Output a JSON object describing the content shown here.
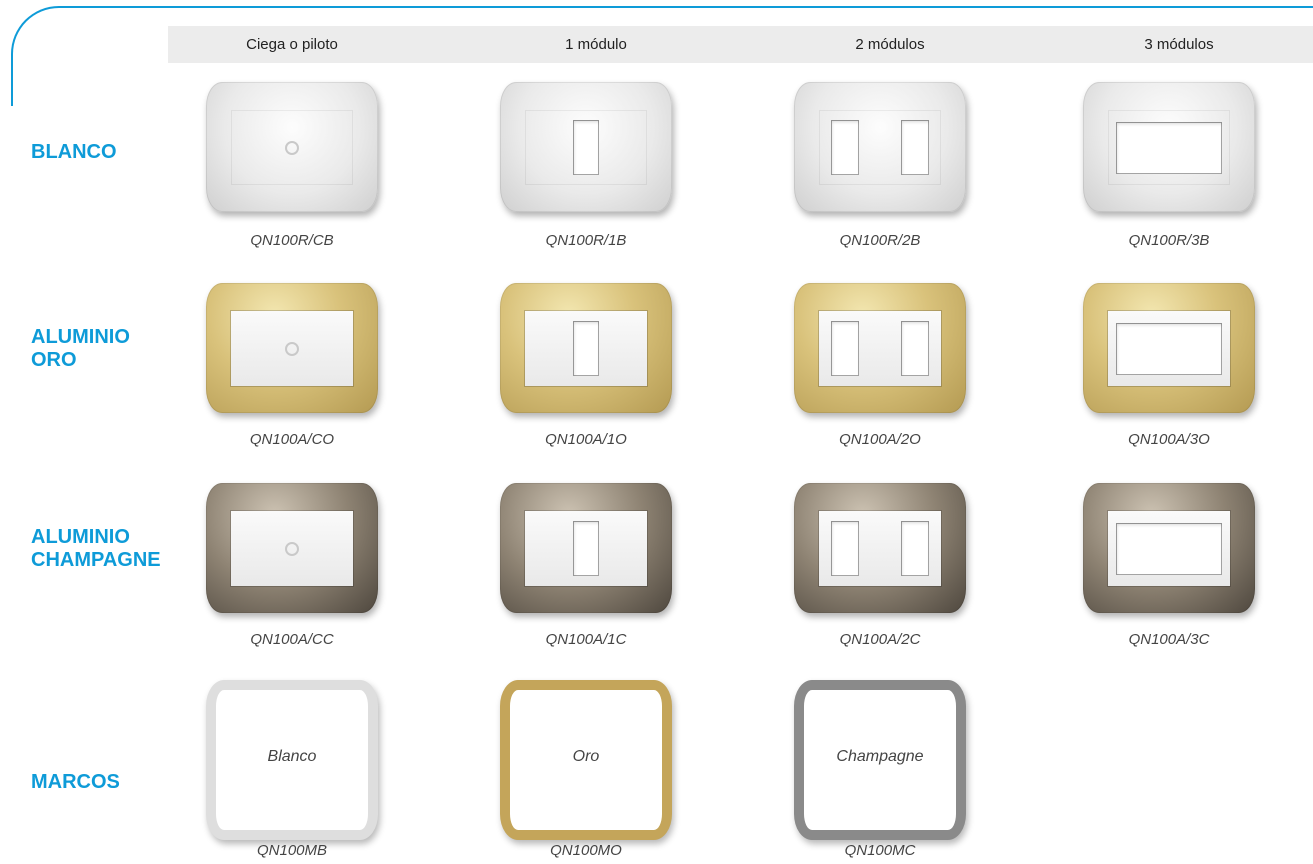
{
  "columns": [
    "Ciega o piloto",
    "1 módulo",
    "2 módulos",
    "3 módulos"
  ],
  "rows": [
    {
      "label_lines": [
        "BLANCO"
      ],
      "finish": "white",
      "codes": [
        "QN100R/CB",
        "QN100R/1B",
        "QN100R/2B",
        "QN100R/3B"
      ]
    },
    {
      "label_lines": [
        "ALUMINIO",
        "ORO"
      ],
      "finish": "gold",
      "codes": [
        "QN100A/CO",
        "QN100A/1O",
        "QN100A/2O",
        "QN100A/3O"
      ]
    },
    {
      "label_lines": [
        "ALUMINIO",
        "CHAMPAGNE"
      ],
      "finish": "champ",
      "codes": [
        "QN100A/CC",
        "QN100A/1C",
        "QN100A/2C",
        "QN100A/3C"
      ]
    }
  ],
  "marcos": {
    "label": "MARCOS",
    "frames": [
      {
        "finish": "white",
        "name": "Blanco",
        "code": "QN100MB"
      },
      {
        "finish": "gold",
        "name": "Oro",
        "code": "QN100MO"
      },
      {
        "finish": "champ",
        "name": "Champagne",
        "code": "QN100MC"
      }
    ]
  },
  "colors": {
    "accent": "#0e9bd8",
    "header_bg": "#ececec"
  }
}
